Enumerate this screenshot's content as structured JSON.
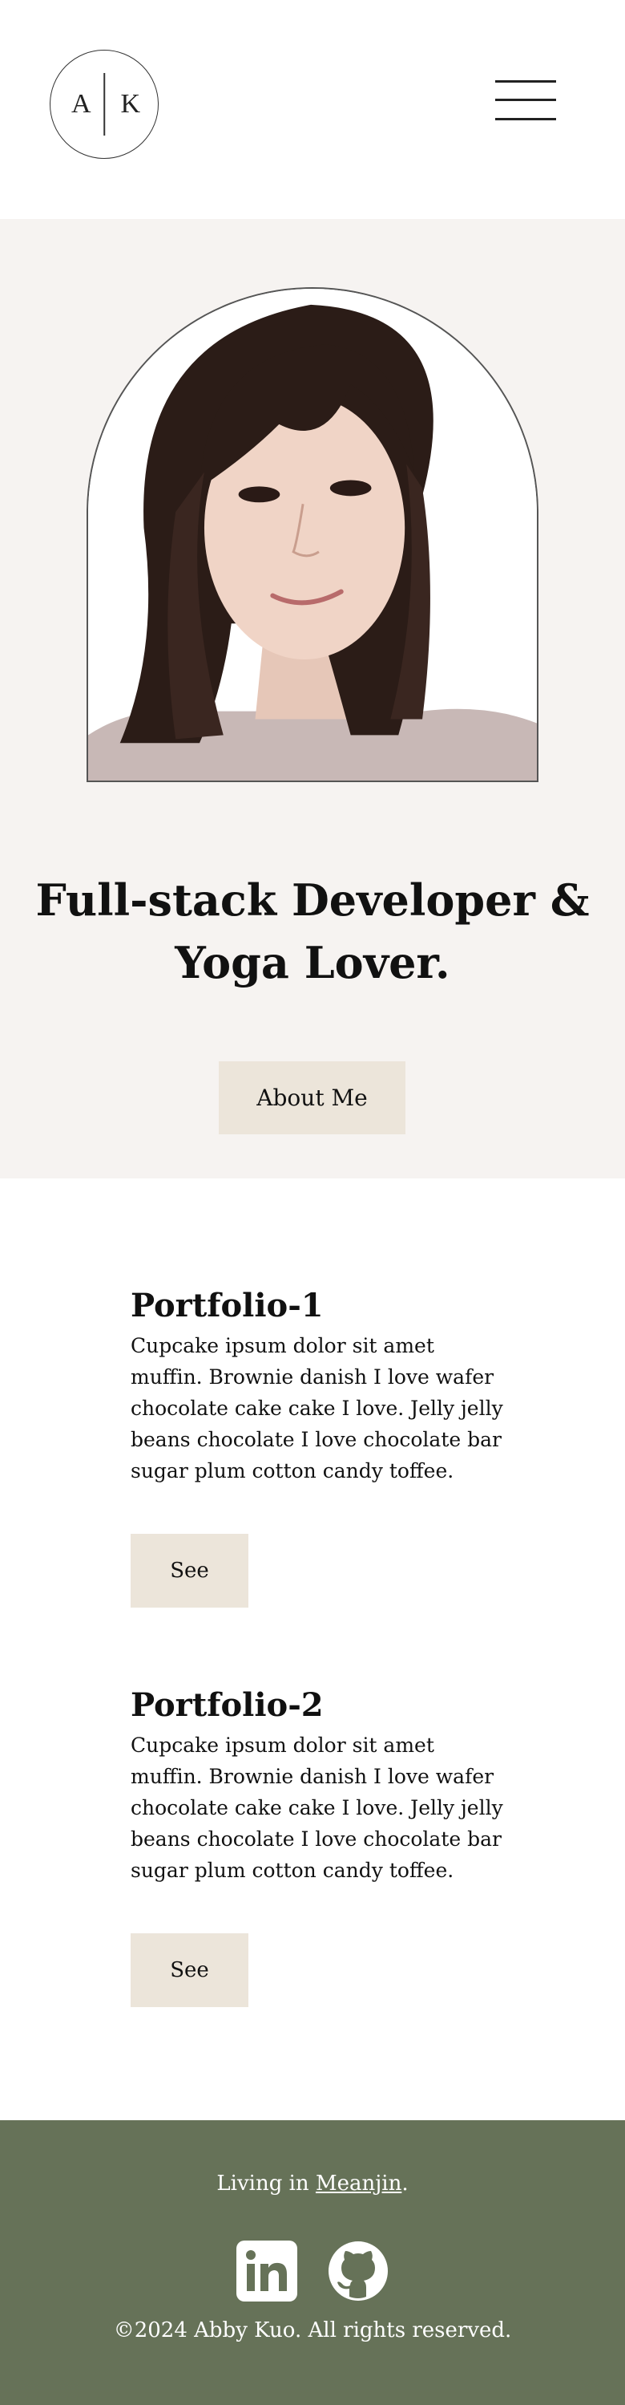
{
  "header": {
    "logo": {
      "left_letter": "A",
      "right_letter": "K"
    },
    "menu_icon": "hamburger-menu-icon"
  },
  "hero": {
    "portrait_alt": "Portrait of Abby Kuo",
    "title_line1": "Full-stack Developer &",
    "title_line2": "Yoga Lover.",
    "button_label": "About Me"
  },
  "portfolio": {
    "items": [
      {
        "title": "Portfolio-1",
        "description": "Cupcake ipsum dolor sit amet muffin. Brownie danish I love wafer chocolate cake cake I love. Jelly jelly beans chocolate I love chocolate bar sugar plum cotton candy toffee.",
        "button_label": "See"
      },
      {
        "title": "Portfolio-2",
        "description": "Cupcake ipsum dolor sit amet muffin. Brownie danish I love wafer chocolate cake cake I love. Jelly jelly beans chocolate I love chocolate bar sugar plum cotton candy toffee.",
        "button_label": "See"
      }
    ]
  },
  "footer": {
    "living_prefix": "Living in ",
    "living_link": "Meanjin",
    "living_suffix": ".",
    "social_icons": [
      "linkedin-icon",
      "github-icon"
    ],
    "copyright": "©2024 Abby Kuo. All rights reserved."
  },
  "colors": {
    "hero_background": "#f6f3f1",
    "button_background": "#ece5da",
    "footer_background": "#667258",
    "text": "#111111"
  }
}
